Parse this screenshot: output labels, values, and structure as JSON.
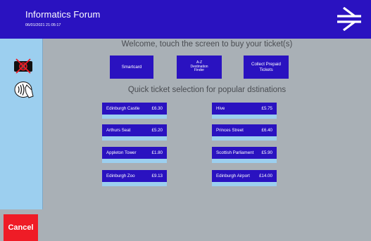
{
  "header": {
    "title": "Informatics Forum",
    "timestamp": "06/01/2021 21:05:17"
  },
  "sidebar": {
    "cancel_label": "Cancel"
  },
  "main": {
    "welcome": "Welcome, touch the screen to buy your ticket(s)",
    "buttons": {
      "smartcard": "Smartcard",
      "az_finder": "A-Z\nDestination\nFinder",
      "collect_prepaid": "Collect Prepaid\nTickets"
    },
    "quick_heading": "Quick ticket selection for popular dstinations",
    "destinations": [
      {
        "name": "Edinburgh Castle",
        "price": "£6.30"
      },
      {
        "name": "Hive",
        "price": "£5.75"
      },
      {
        "name": "Arthurs Seat",
        "price": "£5.20"
      },
      {
        "name": "Princes Street",
        "price": "£6.40"
      },
      {
        "name": "Appleton Tower",
        "price": "£1.80"
      },
      {
        "name": "Scottish Parliament",
        "price": "£5.90"
      },
      {
        "name": "Edinburgh Zoo",
        "price": "£9.13"
      },
      {
        "name": "Edinburgh Airport",
        "price": "£14.00"
      }
    ]
  },
  "colors": {
    "brand_blue": "#2a12c0",
    "light_blue": "#9ccfef",
    "background_grey": "#a9b0b6",
    "cancel_red": "#ef1c26"
  },
  "icons": [
    "national-rail-logo-icon",
    "card-not-accepted-icon",
    "contactless-payment-icon"
  ]
}
